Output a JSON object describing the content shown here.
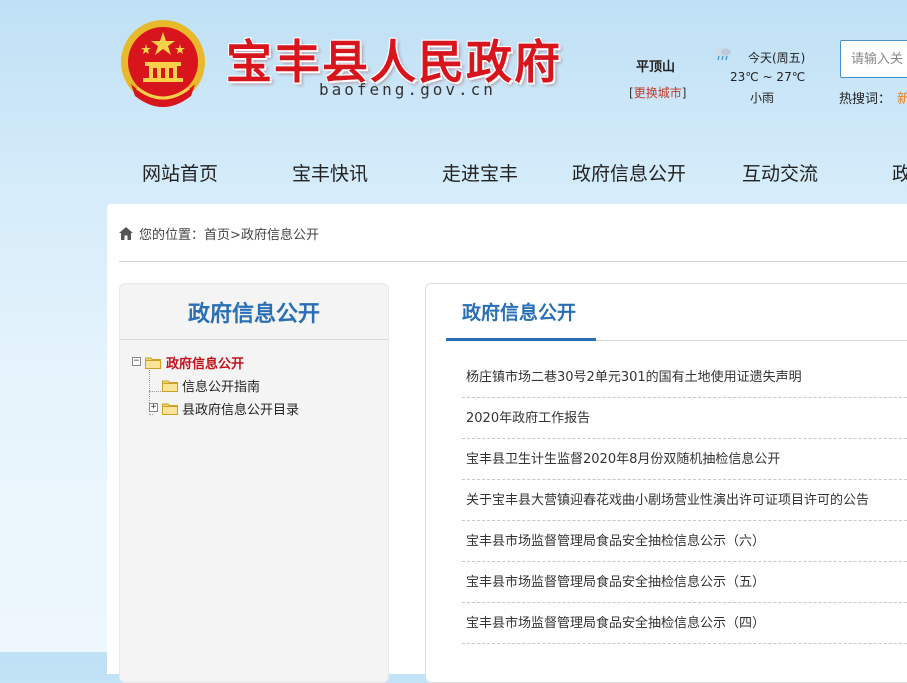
{
  "header": {
    "site_title": "宝丰县人民政府",
    "site_domain": "baofeng.gov.cn",
    "city": "平顶山",
    "city_switch": {
      "bracket_open": "[",
      "label": "更换城市",
      "bracket_close": "]"
    },
    "weather": {
      "day": "今天(周五)",
      "temp": "23℃ ~ 27℃",
      "condition": "小雨",
      "icon": "cloud-rain-icon"
    },
    "search": {
      "placeholder": "请输入关"
    },
    "hot_search": {
      "label": "热搜词：",
      "first_link": "新"
    }
  },
  "nav": {
    "items": [
      {
        "label": "网站首页"
      },
      {
        "label": "宝丰快讯"
      },
      {
        "label": "走进宝丰"
      },
      {
        "label": "政府信息公开"
      },
      {
        "label": "互动交流"
      },
      {
        "label": "政"
      }
    ]
  },
  "breadcrumb": {
    "prefix": "您的位置：",
    "home": "首页",
    "separator": ">",
    "current": "政府信息公开"
  },
  "sidebar": {
    "title": "政府信息公开",
    "tree": [
      {
        "label": "政府信息公开",
        "toggle": "−",
        "active": true
      },
      {
        "label": "信息公开指南"
      },
      {
        "label": "县政府信息公开目录",
        "toggle": "+"
      }
    ]
  },
  "panel": {
    "title": "政府信息公开",
    "items": [
      "杨庄镇市场二巷30号2单元301的国有土地使用证遗失声明",
      "2020年政府工作报告",
      "宝丰县卫生计生监督2020年8月份双随机抽检信息公开",
      "关于宝丰县大营镇迎春花戏曲小剧场营业性演出许可证项目许可的公告",
      "宝丰县市场监督管理局食品安全抽检信息公示（六）",
      "宝丰县市场监督管理局食品安全抽检信息公示（五）",
      "宝丰县市场监督管理局食品安全抽检信息公示（四）"
    ]
  },
  "colors": {
    "title_red": "#d8141c",
    "accent_blue": "#2a6fb4",
    "active_red": "#c0141c",
    "hot_orange": "#e67e22"
  }
}
